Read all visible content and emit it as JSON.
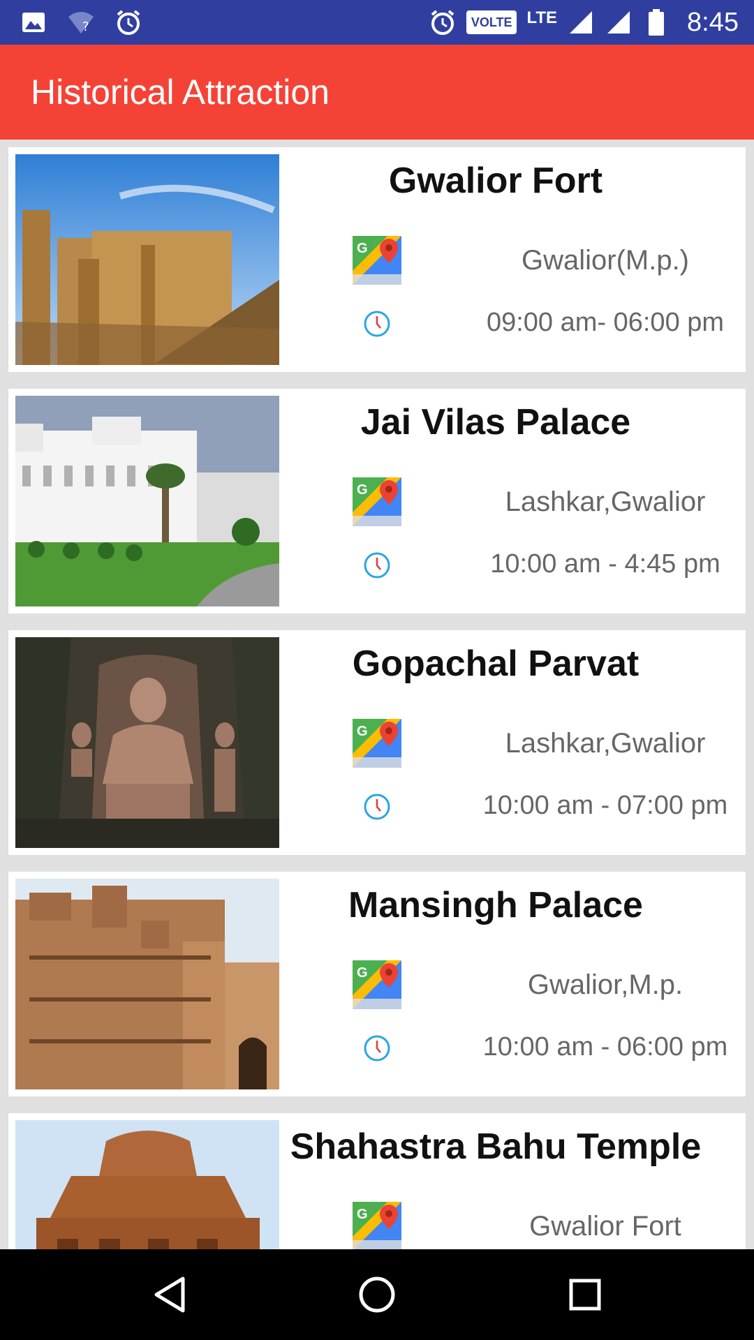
{
  "status_bar": {
    "time": "8:45",
    "volte": "VOLTE",
    "lte": "LTE",
    "left_icons": [
      "image-icon",
      "wifi-question-icon",
      "alarm-icon"
    ],
    "right_icons": [
      "alarm-icon",
      "volte-badge",
      "signal-icon",
      "signal-icon",
      "battery-icon"
    ]
  },
  "toolbar": {
    "title": "Historical Attraction",
    "color": "#f44336"
  },
  "attractions": [
    {
      "name": "Gwalior Fort",
      "location": "Gwalior(M.p.)",
      "hours": "09:00 am- 06:00 pm"
    },
    {
      "name": "Jai Vilas Palace",
      "location": "Lashkar,Gwalior",
      "hours": "10:00 am - 4:45 pm"
    },
    {
      "name": "Gopachal Parvat",
      "location": "Lashkar,Gwalior",
      "hours": "10:00 am - 07:00 pm"
    },
    {
      "name": "Mansingh Palace",
      "location": "Gwalior,M.p.",
      "hours": "10:00 am - 06:00 pm"
    },
    {
      "name": "Shahastra Bahu Temple",
      "location": "Gwalior Fort",
      "hours": ""
    }
  ],
  "nav_bar": {
    "buttons": [
      "back-icon",
      "home-icon",
      "recents-icon"
    ]
  },
  "colors": {
    "status_bar": "#303f9f",
    "toolbar": "#f44336",
    "list_background": "#e0e0e0"
  }
}
